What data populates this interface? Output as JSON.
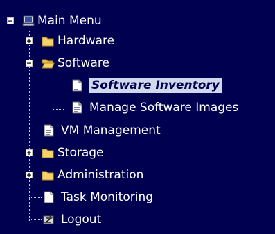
{
  "menu": {
    "root": {
      "label": "Main Menu",
      "icon": "computer-icon",
      "expanded": true
    },
    "items": [
      {
        "label": "Hardware",
        "icon": "folder-closed-icon",
        "expandable": true,
        "expanded": false
      },
      {
        "label": "Software",
        "icon": "folder-open-icon",
        "expandable": true,
        "expanded": true,
        "children": [
          {
            "label": "Software Inventory",
            "icon": "page-icon",
            "selected": true
          },
          {
            "label": "Manage Software Images",
            "icon": "page-icon",
            "selected": false
          }
        ]
      },
      {
        "label": "VM Management",
        "icon": "page-icon",
        "expandable": false
      },
      {
        "label": "Storage",
        "icon": "folder-closed-icon",
        "expandable": true,
        "expanded": false
      },
      {
        "label": "Administration",
        "icon": "folder-closed-icon",
        "expandable": true,
        "expanded": false
      },
      {
        "label": "Task Monitoring",
        "icon": "page-icon",
        "expandable": false
      },
      {
        "label": "Logout",
        "icon": "logout-icon",
        "expandable": false
      }
    ]
  },
  "colors": {
    "background": "#000050",
    "text": "#ffffff",
    "selected_bg": "#cfd8ec",
    "selected_text": "#000050",
    "folder": "#f5d36b"
  }
}
